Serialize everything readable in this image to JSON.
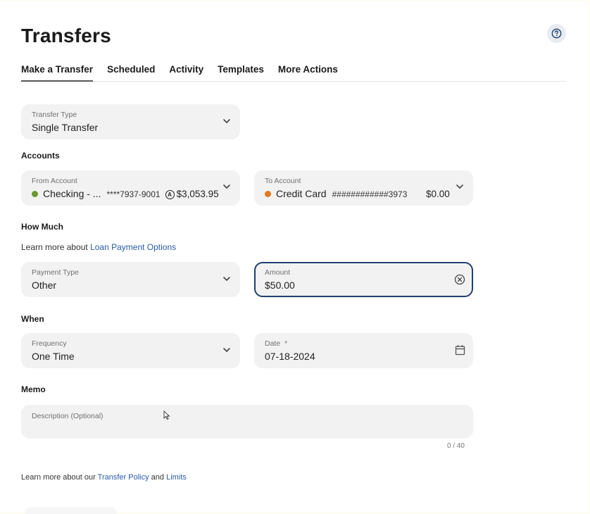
{
  "header": {
    "title": "Transfers",
    "help_icon": "question-circle-icon"
  },
  "tabs": [
    {
      "label": "Make a Transfer",
      "active": true
    },
    {
      "label": "Scheduled",
      "active": false
    },
    {
      "label": "Activity",
      "active": false
    },
    {
      "label": "Templates",
      "active": false
    },
    {
      "label": "More Actions",
      "active": false
    }
  ],
  "transfer_type": {
    "label": "Transfer Type",
    "value": "Single Transfer"
  },
  "accounts": {
    "section_title": "Accounts",
    "from": {
      "label": "From Account",
      "name": "Checking - ...",
      "number": "****7937-9001",
      "available_icon": "A",
      "balance": "$3,053.95",
      "dot_color": "#6a9a2e"
    },
    "to": {
      "label": "To Account",
      "name": "Credit Card",
      "number": "############3973",
      "balance": "$0.00",
      "dot_color": "#e07a1f"
    }
  },
  "how_much": {
    "section_title": "How Much",
    "help_prefix": "Learn more about ",
    "help_link": "Loan Payment Options",
    "payment_type": {
      "label": "Payment Type",
      "value": "Other"
    },
    "amount": {
      "label": "Amount",
      "value": "$50.00"
    }
  },
  "when": {
    "section_title": "When",
    "frequency": {
      "label": "Frequency",
      "value": "One Time"
    },
    "date": {
      "label": "Date",
      "required_mark": "*",
      "value": "07-18-2024"
    }
  },
  "memo": {
    "section_title": "Memo",
    "placeholder": "Description (Optional)",
    "counter": "0 / 40"
  },
  "footer": {
    "prefix": "Learn more about our ",
    "policy_link": "Transfer Policy",
    "conjunction": " and ",
    "limits_link": "Limits"
  },
  "colors": {
    "accent": "#2a5aa8",
    "focus_border": "#1f3f6e",
    "field_bg": "#f2f2f2"
  }
}
